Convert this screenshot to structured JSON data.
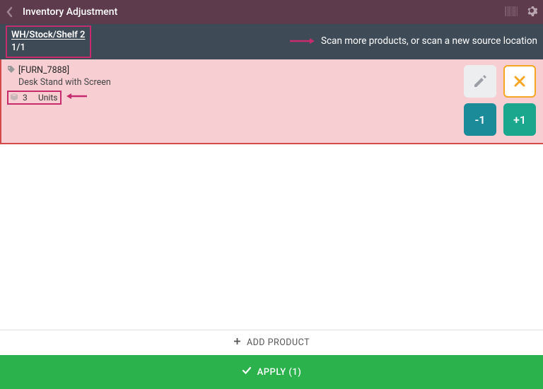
{
  "header": {
    "title": "Inventory Adjustment"
  },
  "location_bar": {
    "path": "WH/Stock/Shelf 2",
    "count": "1/1",
    "hint": "Scan more products, or scan a new source location"
  },
  "product": {
    "sku": "[FURN_7888]",
    "name": "Desk Stand with Screen",
    "qty": "3",
    "unit": "Units",
    "minus_label": "-1",
    "plus_label": "+1"
  },
  "footer": {
    "add_label": "ADD PRODUCT",
    "apply_label": "APPLY (1)"
  }
}
